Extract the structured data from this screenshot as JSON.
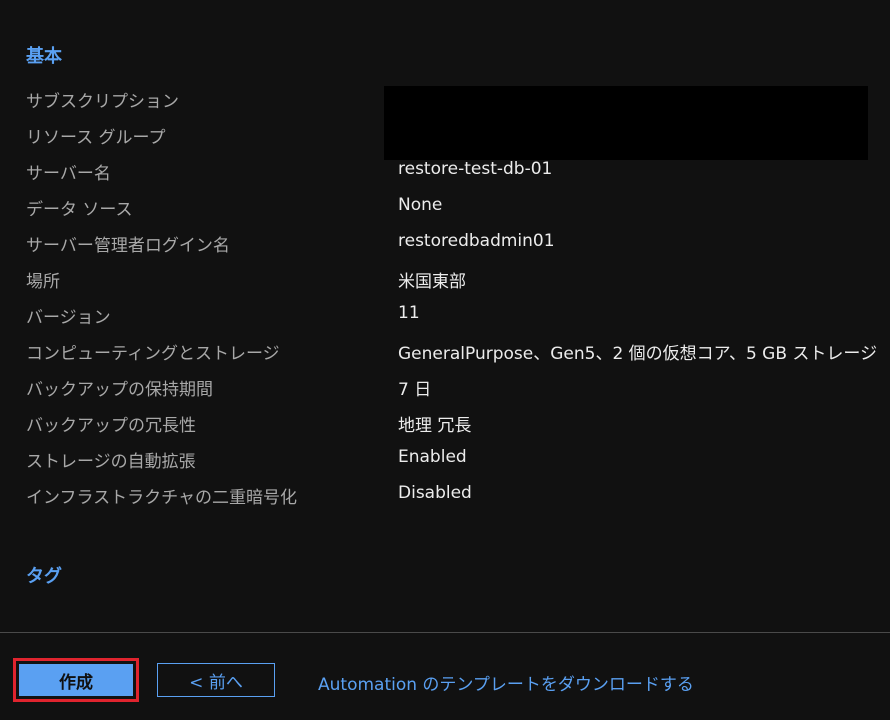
{
  "sections": {
    "basic_title": "基本",
    "tags_title": "タグ"
  },
  "rows": [
    {
      "label": "サブスクリプション",
      "value": ""
    },
    {
      "label": "リソース グループ",
      "value": ""
    },
    {
      "label": "サーバー名",
      "value": "restore-test-db-01"
    },
    {
      "label": "データ ソース",
      "value": "None"
    },
    {
      "label": "サーバー管理者ログイン名",
      "value": "restoredbadmin01"
    },
    {
      "label": "場所",
      "value": "米国東部"
    },
    {
      "label": "バージョン",
      "value": "11"
    },
    {
      "label": "コンピューティングとストレージ",
      "value": "GeneralPurpose、Gen5、2 個の仮想コア、5 GB ストレージ"
    },
    {
      "label": "バックアップの保持期間",
      "value": "7 日"
    },
    {
      "label": "バックアップの冗長性",
      "value": "地理 冗長"
    },
    {
      "label": "ストレージの自動拡張",
      "value": "Enabled"
    },
    {
      "label": "インフラストラクチャの二重暗号化",
      "value": "Disabled"
    }
  ],
  "footer": {
    "create_label": "作成",
    "prev_label": "< 前へ",
    "download_link": "Automation のテンプレートをダウンロードする"
  },
  "colors": {
    "background": "#111111",
    "accent": "#5aa0f2",
    "highlight_border": "#e0242e"
  }
}
